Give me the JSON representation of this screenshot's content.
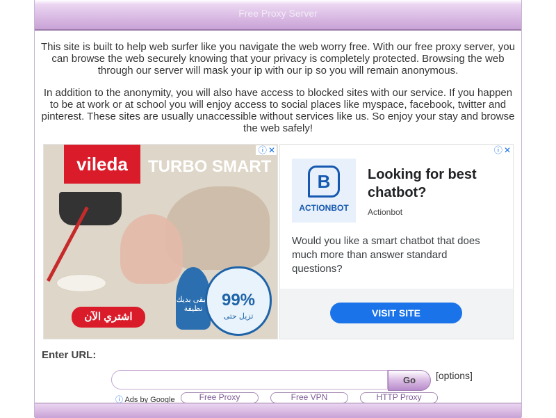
{
  "header": {
    "title": "Free Proxy Server"
  },
  "intro": {
    "p1": "This site is built to help web surfer like you navigate the web worry free. With our free proxy server, you can browse the web securely knowing that your privacy is completely protected. Browsing the web through our server will mask your ip with our ip so you will remain anonymous.",
    "p2": "In addition to the anonymity, you will also have access to blocked sites with our service. If you happen to be at work or at school you will enjoy access to social places like myspace, facebook, twitter and pinterest. These sites are usually unaccessible without services like us. So enjoy your stay and browse the web safely!"
  },
  "ad_left": {
    "brand": "vileda",
    "product": "TURBO SMART",
    "cta_arabic": "اشتري الآن",
    "badge_number": "99%",
    "badge_text": "تزيل حتى",
    "side_text": "لتبقى بديك نظيفة",
    "choices_info": "ⓘ",
    "choices_close": "✕"
  },
  "ad_right": {
    "logo_glyph": "B",
    "logo_name": "ACTIONBOT",
    "headline": "Looking for best chatbot?",
    "advertiser": "Actionbot",
    "body": "Would you like a smart chatbot that does much more than answer standard questions?",
    "cta": "VISIT SITE",
    "choices_info": "ⓘ",
    "choices_close": "✕"
  },
  "form": {
    "label": "Enter URL:",
    "input_value": "",
    "input_placeholder": "",
    "go_label": "Go",
    "options_label": "[options]"
  },
  "ads_by": {
    "icon": "ⓘ",
    "text": "Ads by Google"
  },
  "quick_links": [
    "Free Proxy",
    "Free VPN",
    "HTTP Proxy"
  ],
  "colors": {
    "header_gradient_top": "#ebd6f2",
    "header_gradient_bottom": "#c9a2d6",
    "accent_purple": "#7c5b96",
    "ad_cta_blue": "#1a73e8",
    "vileda_red": "#d91b2a"
  }
}
